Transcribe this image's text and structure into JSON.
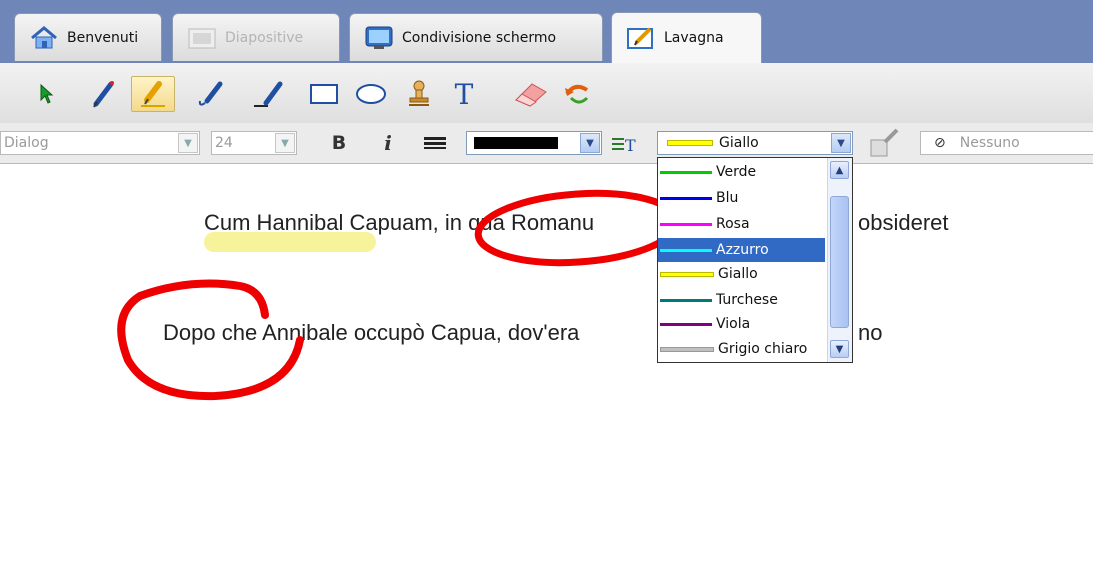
{
  "tabs": [
    {
      "label": "Benvenuti",
      "icon": "home-icon",
      "state": "normal"
    },
    {
      "label": "Diapositive",
      "icon": "slides-icon",
      "state": "disabled"
    },
    {
      "label": "Condivisione schermo",
      "icon": "monitor-icon",
      "state": "normal"
    },
    {
      "label": "Lavagna",
      "icon": "whiteboard-icon",
      "state": "active"
    }
  ],
  "tools": [
    "select-arrow-icon",
    "pen-icon",
    "highlighter-icon",
    "curve-pen-icon",
    "line-pen-icon",
    "rectangle-icon",
    "ellipse-icon",
    "stamp-icon",
    "text-tool-icon",
    "eraser-icon",
    "undo-icon"
  ],
  "format_bar": {
    "font": "Dialog",
    "size": "24",
    "bold_label": "B",
    "italic_label": "i",
    "text_color_label": "Giallo",
    "fill_label": "Nessuno",
    "fill_icon": "⊘"
  },
  "canvas": {
    "line1": "Cum Hannibal Capuam, in qua Romanu",
    "line1_end": "obsideret",
    "line2": "Dopo che Annibale occupò Capua, dov'era",
    "line2_end": "no"
  },
  "dropdown": {
    "selected": "Azzurro",
    "items": [
      {
        "label": "Verde",
        "color": "#00cc00"
      },
      {
        "label": "Blu",
        "color": "#0000ee"
      },
      {
        "label": "Rosa",
        "color": "#ff00ff"
      },
      {
        "label": "Azzurro",
        "color": "#00ffff"
      },
      {
        "label": "Giallo",
        "color": "#ffff00"
      },
      {
        "label": "Turchese",
        "color": "#007a78"
      },
      {
        "label": "Viola",
        "color": "#800080"
      },
      {
        "label": "Grigio chiaro",
        "color": "#c0c0c0"
      }
    ]
  },
  "colors": {
    "tabbar": "#6e87b8",
    "selection": "#316ac5",
    "annotation_red": "#ee0000",
    "highlight_yellow": "#f5f08a"
  }
}
